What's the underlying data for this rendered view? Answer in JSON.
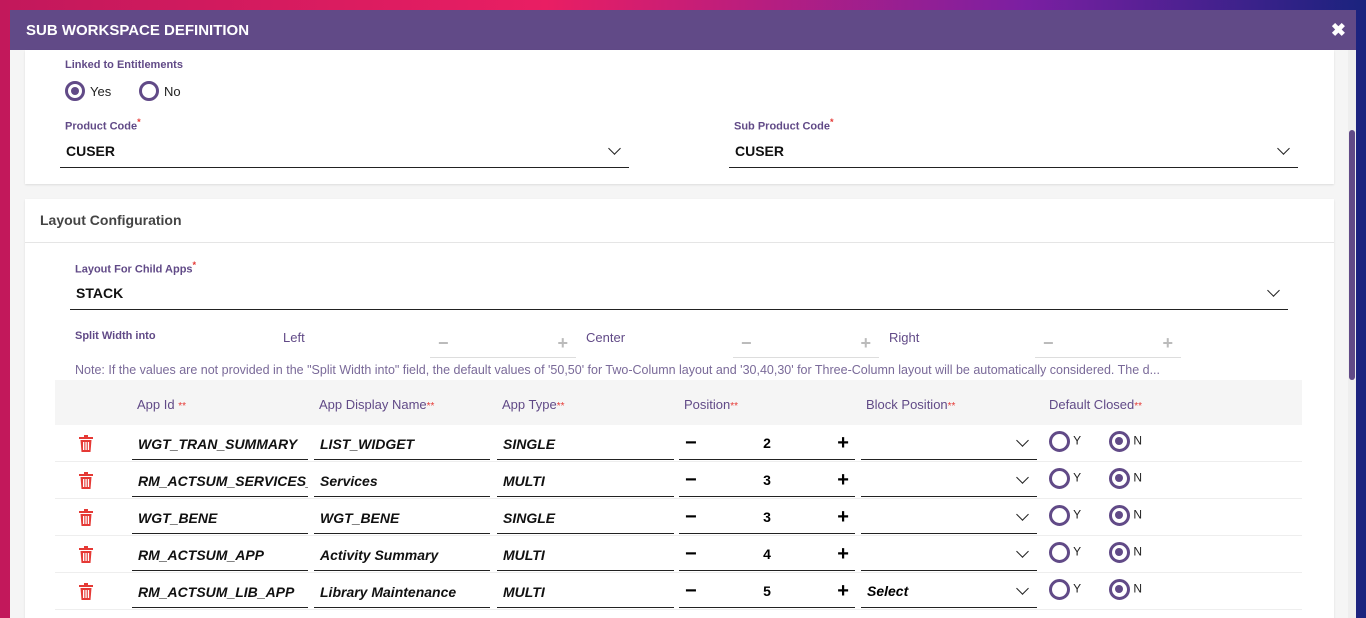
{
  "modal": {
    "title": "SUB WORKSPACE DEFINITION",
    "close_icon": "close-icon"
  },
  "entitlements": {
    "label": "Linked to Entitlements",
    "options": [
      "Yes",
      "No"
    ],
    "selected": "Yes"
  },
  "product_code": {
    "label": "Product Code",
    "required": "*",
    "value": "CUSER"
  },
  "sub_product_code": {
    "label": "Sub Product Code",
    "required": "*",
    "value": "CUSER"
  },
  "layout": {
    "section_title": "Layout Configuration",
    "child_label": "Layout For Child Apps",
    "required": "*",
    "child_value": "STACK",
    "split_label": "Split Width into",
    "left": "Left",
    "center": "Center",
    "right": "Right",
    "minus": "−",
    "plus": "+",
    "note": "Note: If the values are not provided in the \"Split Width into\" field, the default values of '50,50' for Two-Column layout and '30,40,30' for Three-Column layout will be automatically considered. The d..."
  },
  "table": {
    "headers": [
      {
        "label": "App Id ",
        "req": "**"
      },
      {
        "label": "App Display Name",
        "req": "**"
      },
      {
        "label": "App Type",
        "req": "**"
      },
      {
        "label": "Position",
        "req": "**"
      },
      {
        "label": "Block Position",
        "req": "**"
      },
      {
        "label": "Default Closed",
        "req": "**"
      }
    ],
    "rows": [
      {
        "app_id": "WGT_TRAN_SUMMARY",
        "display": "LIST_WIDGET",
        "type": "SINGLE",
        "position": "2",
        "block": "",
        "closed": "N"
      },
      {
        "app_id": "RM_ACTSUM_SERVICES_APP",
        "display": "Services",
        "type": "MULTI",
        "position": "3",
        "block": "",
        "closed": "N"
      },
      {
        "app_id": "WGT_BENE",
        "display": "WGT_BENE",
        "type": "SINGLE",
        "position": "3",
        "block": "",
        "closed": "N"
      },
      {
        "app_id": "RM_ACTSUM_APP",
        "display": "Activity Summary",
        "type": "MULTI",
        "position": "4",
        "block": "",
        "closed": "N"
      },
      {
        "app_id": "RM_ACTSUM_LIB_APP",
        "display": "Library Maintenance",
        "type": "MULTI",
        "position": "5",
        "block": "Select",
        "closed": "N"
      }
    ],
    "yes": "Y",
    "no": "N",
    "minus": "−",
    "plus": "+"
  },
  "colors": {
    "primary": "#614a87",
    "required": "#e53935",
    "delete": "#e53935"
  }
}
